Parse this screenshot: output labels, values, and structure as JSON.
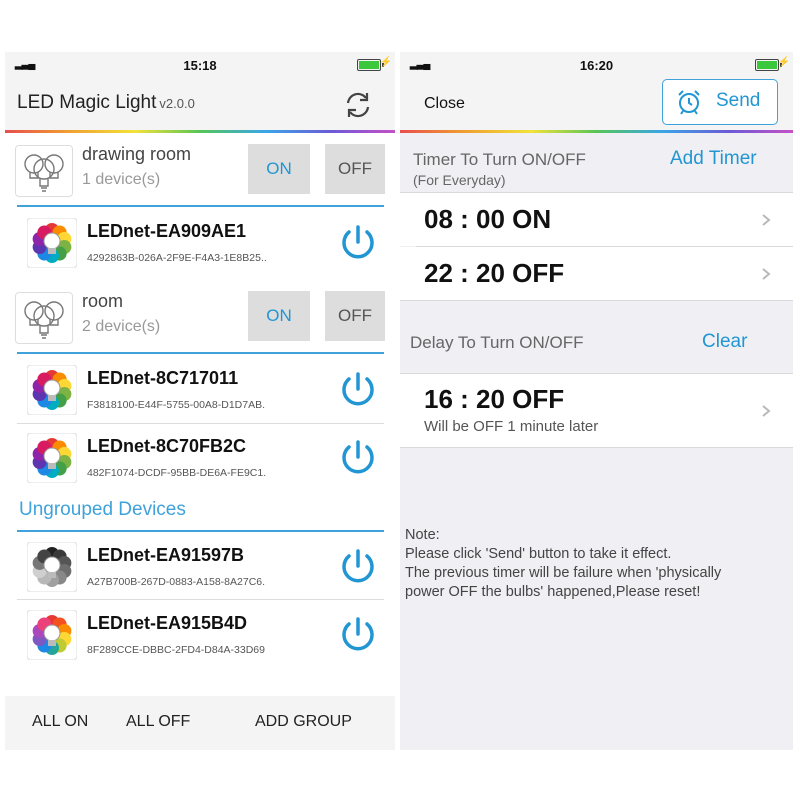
{
  "left": {
    "status": {
      "time": "15:18"
    },
    "nav": {
      "title": "LED Magic Light",
      "version": "v2.0.0"
    },
    "groups": [
      {
        "name": "drawing room",
        "count": "1 device(s)",
        "on_label": "ON",
        "off_label": "OFF",
        "devices": [
          {
            "name": "LEDnet-EA909AE1",
            "id": "4292863B-026A-2F9E-F4A3-1E8B25..",
            "icon": "color-bulb-icon"
          }
        ]
      },
      {
        "name": "room",
        "count": "2 device(s)",
        "on_label": "ON",
        "off_label": "OFF",
        "devices": [
          {
            "name": "LEDnet-8C717011",
            "id": "F3818100-E44F-5755-00A8-D1D7AB.",
            "icon": "color-bulb-icon"
          },
          {
            "name": "LEDnet-8C70FB2C",
            "id": "482F1074-DCDF-95BB-DE6A-FE9C1.",
            "icon": "color-bulb-icon"
          }
        ]
      }
    ],
    "ungrouped_label": "Ungrouped Devices",
    "ungrouped": [
      {
        "name": "LEDnet-EA91597B",
        "id": "A27B700B-267D-0883-A158-8A27C6.",
        "icon": "grey-bulb-icon"
      },
      {
        "name": "LEDnet-EA915B4D",
        "id": "8F289CCE-DBBC-2FD4-D84A-33D69",
        "icon": "color-bulb-icon"
      }
    ],
    "bottom": {
      "all_on": "ALL ON",
      "all_off": "ALL OFF",
      "add_group": "ADD GROUP"
    }
  },
  "right": {
    "status": {
      "time": "16:20"
    },
    "nav": {
      "close": "Close",
      "send": "Send"
    },
    "timer": {
      "title": "Timer To Turn ON/OFF",
      "subtitle": "(For Everyday)",
      "action": "Add Timer"
    },
    "timers": [
      {
        "text": "08 : 00  ON"
      },
      {
        "text": "22 : 20  OFF"
      }
    ],
    "delay": {
      "title": "Delay To Turn ON/OFF",
      "action": "Clear",
      "text": "16 : 20  OFF",
      "sub": "Will be OFF 1 minute later"
    },
    "note": {
      "heading": "Note:",
      "lines": [
        "Please click 'Send' button to take it effect.",
        "The previous timer will be failure when 'physically",
        "power OFF the bulbs' happened,Please reset!"
      ]
    }
  },
  "colors": {
    "accent": "#2196d3",
    "separator": "#3fa2da",
    "button_bg": "#dddddd"
  }
}
